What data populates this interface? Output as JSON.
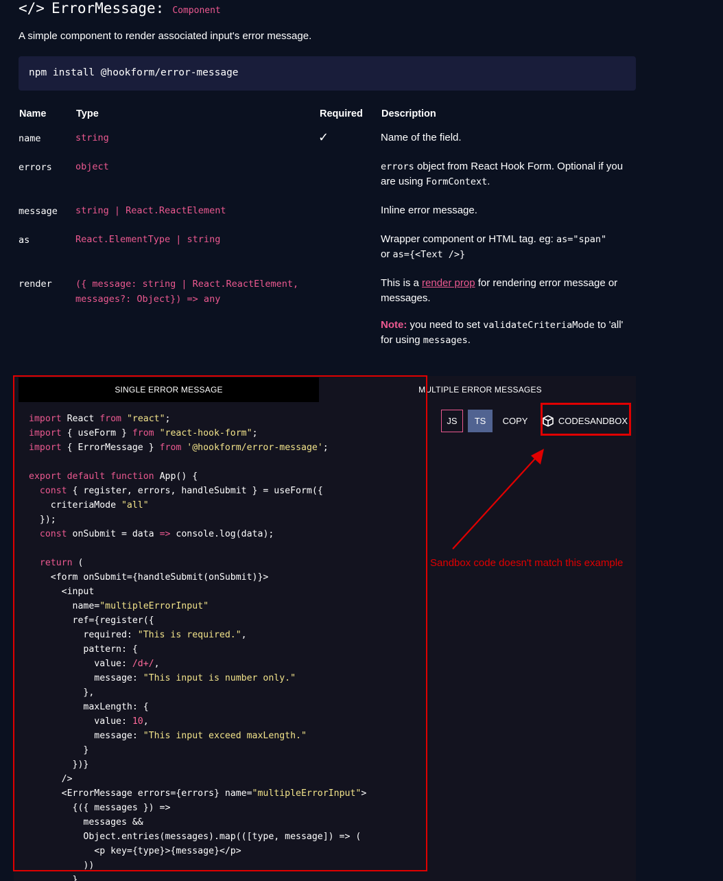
{
  "header": {
    "icon_text": "</>",
    "title": "ErrorMessage:",
    "tag": "Component",
    "description": "A simple component to render associated input's error message."
  },
  "install": {
    "command": "npm install @hookform/error-message"
  },
  "props_table": {
    "headers": {
      "name": "Name",
      "type": "Type",
      "required": "Required",
      "description": "Description"
    },
    "rows": [
      {
        "name": "name",
        "type": "string",
        "required": "✓",
        "description": "Name of the field."
      },
      {
        "name": "errors",
        "type": "object",
        "required": "",
        "description_parts": [
          "errors",
          " object from React Hook Form. Optional if you are using ",
          "FormContext",
          "."
        ]
      },
      {
        "name": "message",
        "type": "string | React.ReactElement",
        "required": "",
        "description": "Inline error message."
      },
      {
        "name": "as",
        "type": "React.ElementType | string",
        "required": "",
        "description_parts": [
          "Wrapper component or HTML tag. eg: ",
          "as=\"span\"",
          " or ",
          "as={<Text />}"
        ]
      },
      {
        "name": "render",
        "type_line1": "({ message: string | React.ReactElement,",
        "type_line2": "messages?: Object}) => any",
        "required": "",
        "description_parts": [
          "This is a ",
          "render prop",
          " for rendering error message or messages."
        ],
        "note_parts": [
          "Note:",
          " you need to set ",
          "validateCriteriaMode",
          " to 'all' for using ",
          "messages",
          "."
        ]
      }
    ]
  },
  "code_panel": {
    "tab_single": "SINGLE ERROR MESSAGE",
    "tab_multiple": "MULTIPLE ERROR MESSAGES",
    "buttons": {
      "js": "JS",
      "ts": "TS",
      "copy": "COPY",
      "codesandbox": "CODESANDBOX"
    }
  },
  "annotation": {
    "text": "Sandbox code doesn't match this example",
    "color": "#e00000"
  },
  "colors": {
    "background": "#0b1120",
    "accent": "#ec5990",
    "panel": "#13131f",
    "install_bg": "#191d3a",
    "ts_button": "#516391"
  }
}
